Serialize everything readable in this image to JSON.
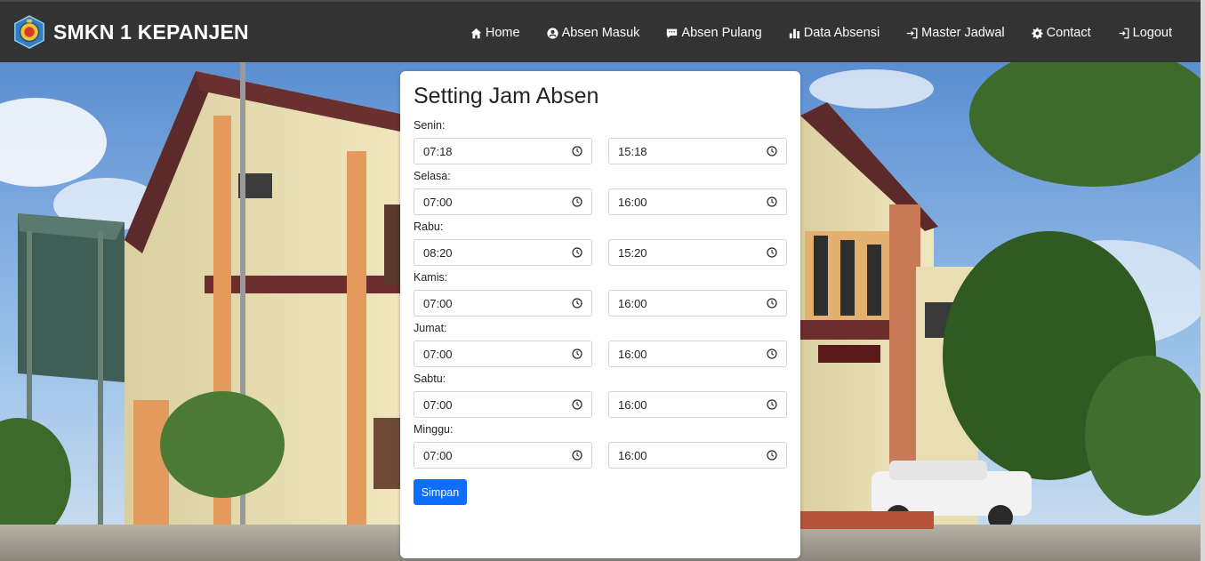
{
  "brand": {
    "title": "SMKN 1 KEPANJEN"
  },
  "nav": [
    {
      "label": "Home",
      "icon": "home-icon"
    },
    {
      "label": "Absen Masuk",
      "icon": "user-circle-icon"
    },
    {
      "label": "Absen Pulang",
      "icon": "comment-icon"
    },
    {
      "label": "Data Absensi",
      "icon": "bar-chart-icon"
    },
    {
      "label": "Master Jadwal",
      "icon": "sign-in-icon"
    },
    {
      "label": "Contact",
      "icon": "gear-icon"
    },
    {
      "label": "Logout",
      "icon": "sign-out-icon"
    }
  ],
  "form": {
    "title": "Setting Jam Absen",
    "days": [
      {
        "label": "Senin:",
        "start": "07:18",
        "end": "15:18"
      },
      {
        "label": "Selasa:",
        "start": "07:00",
        "end": "16:00"
      },
      {
        "label": "Rabu:",
        "start": "08:20",
        "end": "15:20"
      },
      {
        "label": "Kamis:",
        "start": "07:00",
        "end": "16:00"
      },
      {
        "label": "Jumat:",
        "start": "07:00",
        "end": "16:00"
      },
      {
        "label": "Sabtu:",
        "start": "07:00",
        "end": "16:00"
      },
      {
        "label": "Minggu:",
        "start": "07:00",
        "end": "16:00"
      }
    ],
    "save_label": "Simpan"
  },
  "colors": {
    "navbar": "#333333",
    "primary": "#0d6efd",
    "card": "#ffffff"
  }
}
